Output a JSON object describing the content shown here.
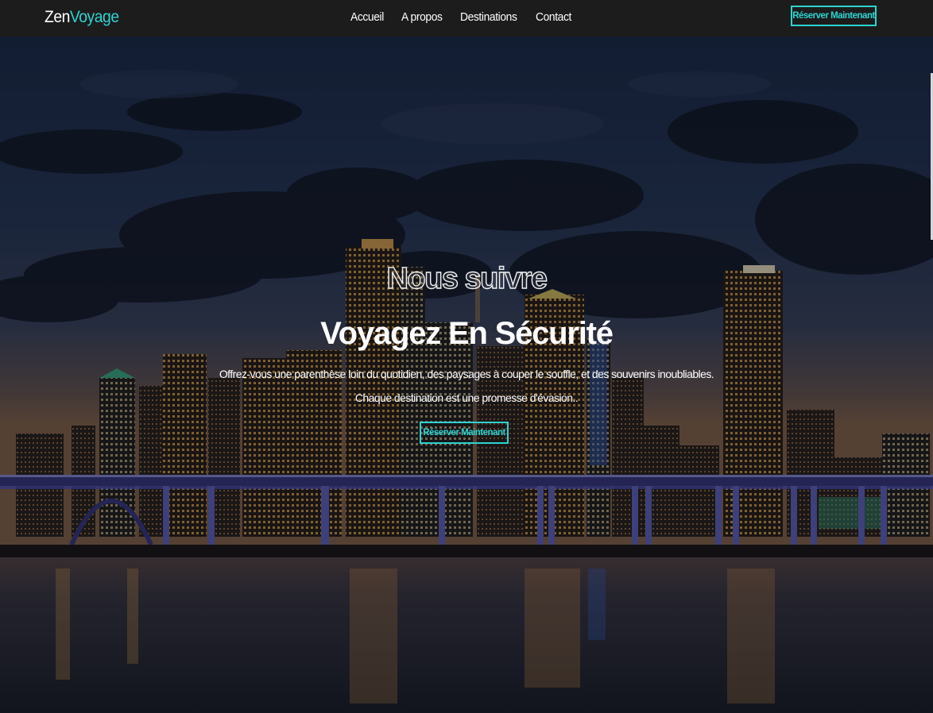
{
  "navbar": {
    "brand_primary": "Zen",
    "brand_accent": "Voyage",
    "links": [
      {
        "label": "Accueil"
      },
      {
        "label": "A propos"
      },
      {
        "label": "Destinations"
      },
      {
        "label": "Contact"
      }
    ],
    "cta_label": "Réserver Maintenant"
  },
  "hero": {
    "subtitle": "Nous suivre",
    "title": "Voyagez En Sécurité",
    "text_line1": "Offrez-vous une parenthèse loin du quotidien, des paysages à couper le souffle, et des souvenirs inoubliables.",
    "text_line2": "Chaque destination est une promesse d'évasion..",
    "cta_label": "Réserver Maintenant"
  },
  "colors": {
    "accent": "#2ed3d0",
    "navbar_bg": "#1c1c1c",
    "text": "#ffffff"
  }
}
